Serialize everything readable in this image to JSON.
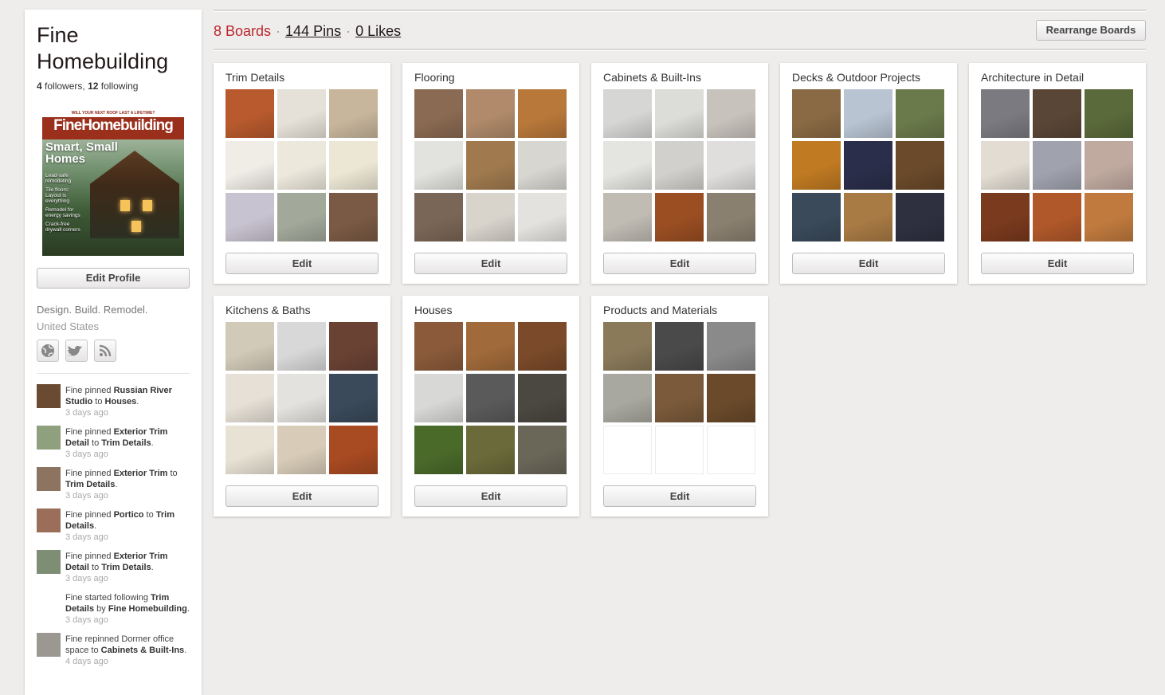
{
  "profile": {
    "name": "Fine Homebuilding",
    "followers_count": "4",
    "followers_label": "followers,",
    "following_count": "12",
    "following_label": "following",
    "edit_profile_label": "Edit Profile",
    "about": "Design. Build. Remodel.",
    "location": "United States",
    "social_icons": [
      "globe-icon",
      "twitter-icon",
      "rss-icon"
    ],
    "magazine": {
      "topline": "WILL YOUR NEXT ROOF LAST A LIFETIME?",
      "title": "FineHomebuilding",
      "headline_1": "Smart, Small",
      "headline_2": "Homes",
      "bullets": [
        "Lead-safe remodeling",
        "Tile floors: Layout is everything",
        "Remodel for energy savings",
        "Crack-free drywall corners"
      ]
    }
  },
  "activity": [
    {
      "pre": "Fine pinned",
      "bold1": "Russian River Studio",
      "mid": "to",
      "bold2": "Houses",
      "post": ".",
      "time": "3 days ago",
      "thumb": "#6b4a32"
    },
    {
      "pre": "Fine pinned",
      "bold1": "Exterior Trim Detail",
      "mid": "to",
      "bold2": "Trim Details",
      "post": ".",
      "time": "3 days ago",
      "thumb": "#8fa07f"
    },
    {
      "pre": "Fine pinned",
      "bold1": "Exterior Trim",
      "mid": "to",
      "bold2": "Trim Details",
      "post": ".",
      "time": "3 days ago",
      "thumb": "#8c7460"
    },
    {
      "pre": "Fine pinned",
      "bold1": "Portico",
      "mid": "to",
      "bold2": "Trim Details",
      "post": ".",
      "time": "3 days ago",
      "thumb": "#9b6e5a"
    },
    {
      "pre": "Fine pinned",
      "bold1": "Exterior Trim Detail",
      "mid": "to",
      "bold2": "Trim Details",
      "post": ".",
      "time": "3 days ago",
      "thumb": "#7d8e74"
    },
    {
      "pre": "Fine started following",
      "bold1": "Trim Details",
      "mid": "by",
      "bold2": "Fine Homebuilding",
      "post": ".",
      "time": "3 days ago",
      "thumb": ""
    },
    {
      "pre": "Fine repinned Dormer office space",
      "bold1": "",
      "mid": "to",
      "bold2": "Cabinets & Built-Ins",
      "post": ".",
      "time": "4 days ago",
      "thumb": "#9a9890"
    }
  ],
  "stats": {
    "boards": "8 Boards",
    "pins": "144 Pins",
    "likes": "0 Likes",
    "separator": "·",
    "rearrange_label": "Rearrange Boards"
  },
  "boards": [
    {
      "title": "Trim Details",
      "edit_label": "Edit",
      "thumbs": [
        "#b85a2e",
        "#e6e1d8",
        "#c8b69c",
        "#f0ece6",
        "#ede8dc",
        "#ece6d4",
        "#c8c3d0",
        "#a2a89a",
        "#7a5a44"
      ]
    },
    {
      "title": "Flooring",
      "edit_label": "Edit",
      "thumbs": [
        "#8a6a52",
        "#b08a6a",
        "#b8783a",
        "#e2e2de",
        "#a07a4e",
        "#d8d6d0",
        "#7a6656",
        "#d8d4cc",
        "#e4e2de"
      ]
    },
    {
      "title": "Cabinets & Built-Ins",
      "edit_label": "Edit",
      "thumbs": [
        "#d6d6d4",
        "#dcdcd8",
        "#c8c2bc",
        "#e4e4e0",
        "#d2d0cc",
        "#e0dedc",
        "#c0bcb4",
        "#9a4e22",
        "#8a8070"
      ]
    },
    {
      "title": "Decks & Outdoor Projects",
      "edit_label": "Edit",
      "thumbs": [
        "#8a6a44",
        "#b8c4d2",
        "#6a7a4a",
        "#c07a22",
        "#2a2e4a",
        "#6a4a2a",
        "#3a4a5a",
        "#a87a44",
        "#2e3040"
      ]
    },
    {
      "title": "Architecture in Detail",
      "edit_label": "Edit",
      "thumbs": [
        "#7a7a80",
        "#5a4636",
        "#5a6a3a",
        "#e2dcd2",
        "#a0a2ae",
        "#c0aaa0",
        "#7a3a1e",
        "#b0582a",
        "#c07a3e"
      ]
    },
    {
      "title": "Kitchens & Baths",
      "edit_label": "Edit",
      "thumbs": [
        "#d2cab8",
        "#d8d8d8",
        "#6a4234",
        "#e6e0d6",
        "#e4e2de",
        "#3a4a5a",
        "#e8e2d4",
        "#d8ccb8",
        "#a84a22"
      ]
    },
    {
      "title": "Houses",
      "edit_label": "Edit",
      "thumbs": [
        "#8a5a3a",
        "#a06a3a",
        "#7a4a2a",
        "#d8d8d6",
        "#5a5a5a",
        "#4a4840",
        "#4a6a2a",
        "#6a6a3a",
        "#6a6658"
      ]
    },
    {
      "title": "Products and Materials",
      "edit_label": "Edit",
      "thumbs": [
        "#8a7a5a",
        "#4a4a4a",
        "#8a8a8a",
        "#a8a8a0",
        "#7a5a3a",
        "#6a4a2a",
        "",
        "",
        ""
      ]
    }
  ]
}
